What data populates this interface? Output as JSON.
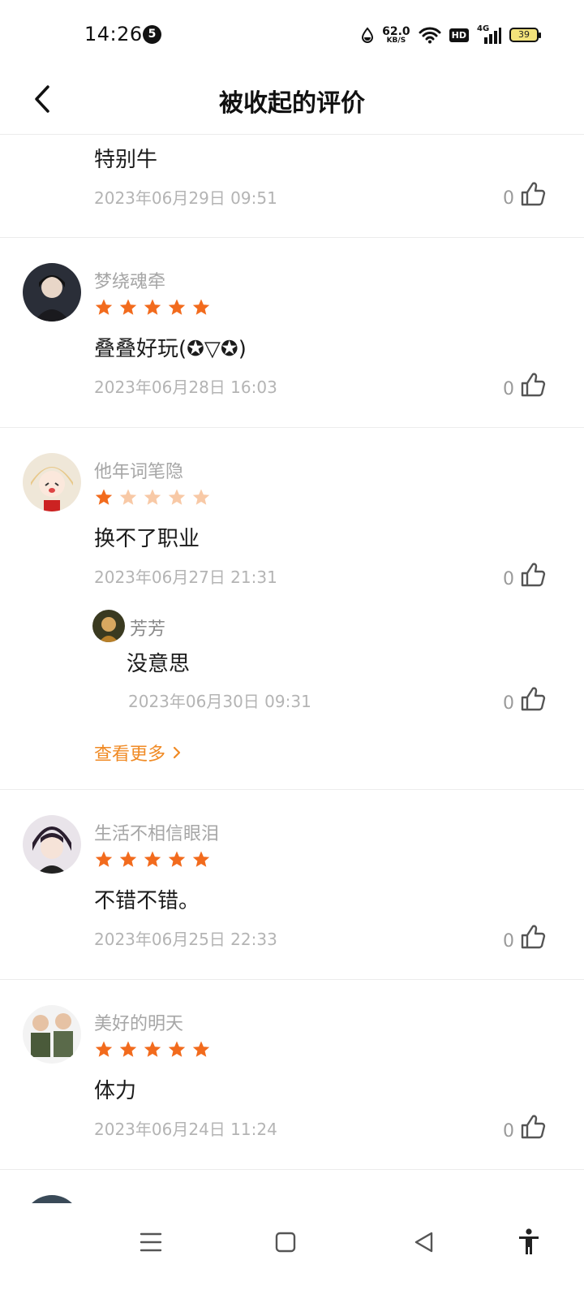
{
  "status_bar": {
    "time": "14:26",
    "notification_count": "5",
    "net_speed_value": "62.0",
    "net_speed_unit": "KB/S",
    "hd_label": "HD",
    "network_label": "4G",
    "battery_level": "39"
  },
  "header": {
    "title": "被收起的评价"
  },
  "reviews": [
    {
      "content": "特别牛",
      "date": "2023年06月29日 09:51",
      "likes": "0"
    },
    {
      "username": "梦绕魂牵",
      "rating": 5,
      "content": "叠叠好玩(✪▽✪)",
      "date": "2023年06月28日 16:03",
      "likes": "0"
    },
    {
      "username": "他年词笔隐",
      "rating": 1,
      "content": "换不了职业",
      "date": "2023年06月27日 21:31",
      "likes": "0",
      "reply": {
        "username": "芳芳",
        "content": "没意思",
        "date": "2023年06月30日 09:31",
        "likes": "0"
      },
      "view_more_label": "查看更多"
    },
    {
      "username": "生活不相信眼泪",
      "rating": 5,
      "content": "不错不错。",
      "date": "2023年06月25日 22:33",
      "likes": "0"
    },
    {
      "username": "美好的明天",
      "rating": 5,
      "content": "体力",
      "date": "2023年06月24日 11:24",
      "likes": "0"
    }
  ],
  "colors": {
    "star_active": "#f26b1d",
    "star_inactive": "#f8c9a6",
    "accent": "#f08a24",
    "divider": "#ececec"
  },
  "icons": {
    "back": "chevron-left-icon",
    "like": "thumbs-up-icon",
    "menu": "menu-icon",
    "home": "home-square-icon",
    "back_triangle": "back-triangle-icon",
    "accessibility": "accessibility-icon"
  }
}
